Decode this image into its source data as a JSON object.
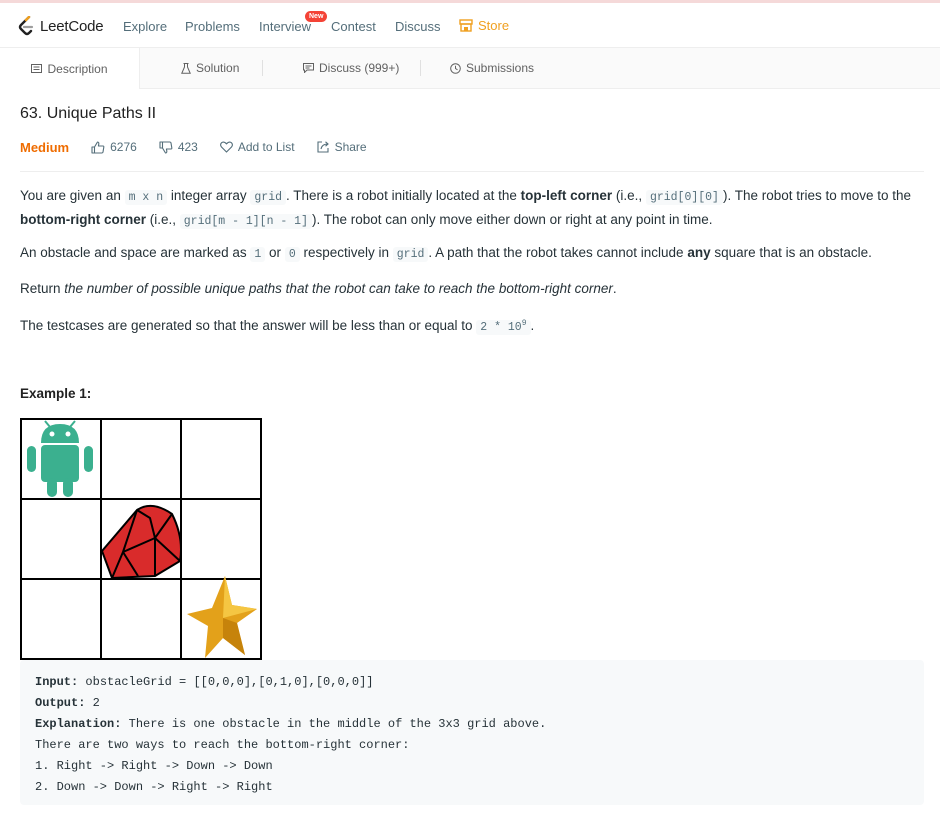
{
  "nav": {
    "logo": "LeetCode",
    "items": [
      "Explore",
      "Problems",
      "Interview",
      "Contest",
      "Discuss"
    ],
    "new_badge": "New",
    "store": "Store",
    "store_color": "#f0a020"
  },
  "tabs": {
    "description": "Description",
    "solution": "Solution",
    "discuss": "Discuss (999+)",
    "submissions": "Submissions"
  },
  "problem": {
    "title": "63. Unique Paths II",
    "difficulty": "Medium",
    "difficulty_color": "#ef6c00",
    "likes": "6276",
    "dislikes": "423",
    "add_to_list": "Add to List",
    "share": "Share"
  },
  "description": {
    "p1": {
      "t1": "You are given an ",
      "c1": "m x n",
      "t2": " integer array ",
      "c2": "grid",
      "t3": ". There is a robot initially located at the ",
      "b1": "top-left corner",
      "t4": " (i.e., ",
      "c3": "grid[0][0]",
      "t5": "). The robot tries to move to the ",
      "b2": "bottom-right corner",
      "t6": " (i.e., ",
      "c4": "grid[m - 1][n - 1]",
      "t7": "). The robot can only move either down or right at any point in time."
    },
    "p2": {
      "t1": "An obstacle and space are marked as ",
      "c1": "1",
      "t2": " or ",
      "c2": "0",
      "t3": " respectively in ",
      "c3": "grid",
      "t4": ". A path that the robot takes cannot include ",
      "b1": "any",
      "t5": " square that is an obstacle."
    },
    "p3": {
      "t1": "Return ",
      "i1": "the number of possible unique paths that the robot can take to reach the bottom-right corner",
      "t2": "."
    },
    "p4": {
      "t1": "The testcases are generated so that the answer will be less than or equal to ",
      "c1": "2 * 10",
      "sup": "9",
      "t2": "."
    }
  },
  "example": {
    "title": "Example 1:",
    "input_label": "Input:",
    "input_value": " obstacleGrid = [[0,0,0],[0,1,0],[0,0,0]]",
    "output_label": "Output:",
    "output_value": " 2",
    "explanation_label": "Explanation:",
    "explanation_value": " There is one obstacle in the middle of the 3x3 grid above.",
    "line4": "There are two ways to reach the bottom-right corner:",
    "line5": "1. Right -> Right -> Down -> Down",
    "line6": "2. Down -> Down -> Right -> Right"
  },
  "grid_image": {
    "rows": 3,
    "cols": 3,
    "start_icon": "android-robot-icon",
    "obstacle_icon": "red-gem-icon",
    "goal_icon": "gold-star-icon"
  }
}
